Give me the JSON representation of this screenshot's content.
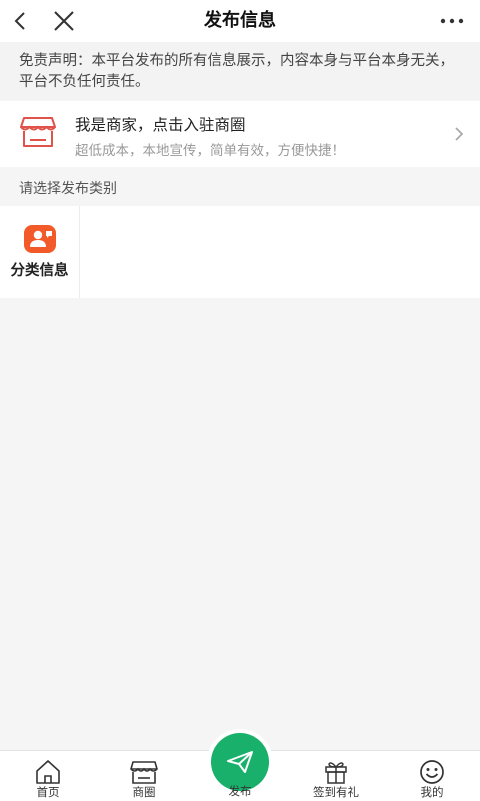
{
  "header": {
    "title": "发布信息",
    "back_icon": "back-arrow-icon",
    "close_icon": "close-icon",
    "more_icon": "more-dots-icon"
  },
  "disclaimer": {
    "text": "免责声明：本平台发布的所有信息展示，内容本身与平台本身无关，平台不负任何责任。"
  },
  "merchant_banner": {
    "title": "我是商家，点击入驻商圈",
    "subtitle": "超低成本，本地宣传，简单有效，方便快捷！",
    "icon": "storefront-icon",
    "chevron_icon": "chevron-right-icon"
  },
  "section": {
    "label": "请选择发布类别"
  },
  "categories": [
    {
      "label": "分类信息",
      "icon": "user-message-icon",
      "icon_color": "#f35a2a"
    }
  ],
  "tabbar": {
    "tabs": [
      {
        "label": "首页",
        "icon": "home-icon"
      },
      {
        "label": "商圈",
        "icon": "shop-icon"
      },
      {
        "label": "发布",
        "icon": "send-icon",
        "active_color": "#18b06a"
      },
      {
        "label": "签到有礼",
        "icon": "gift-icon"
      },
      {
        "label": "我的",
        "icon": "smiley-icon"
      }
    ]
  }
}
